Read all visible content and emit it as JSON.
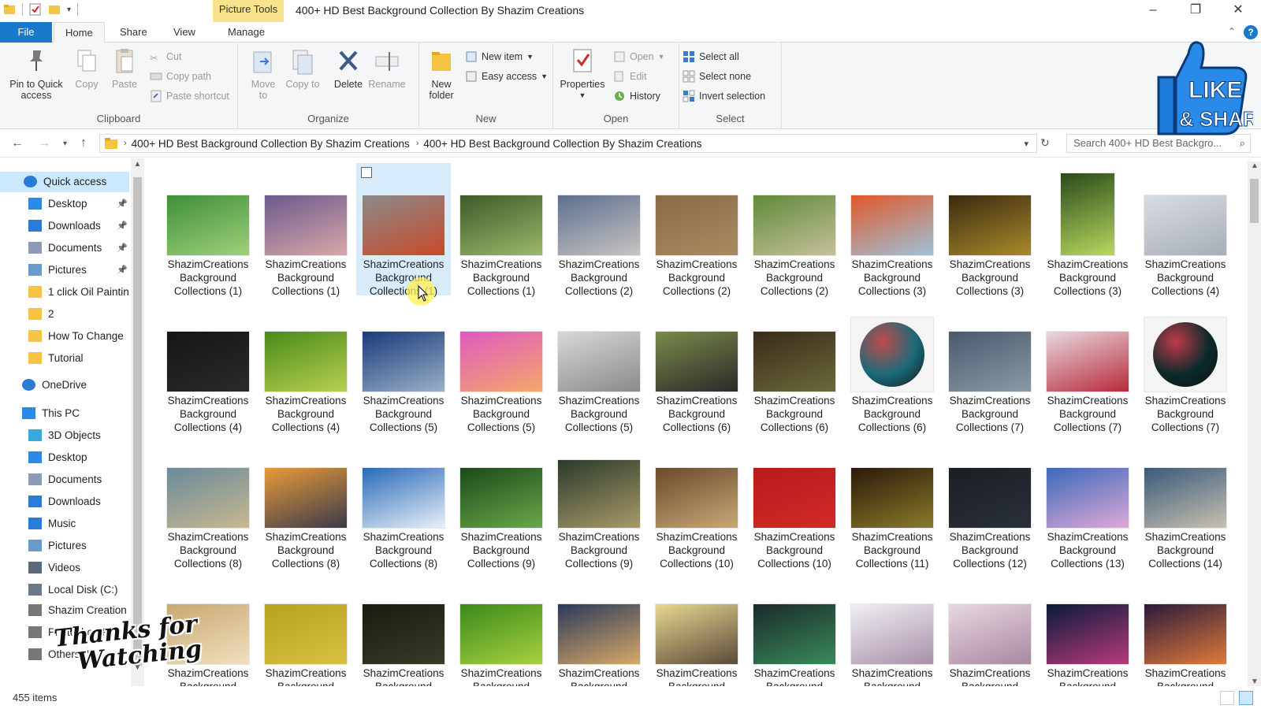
{
  "window": {
    "title": "400+ HD Best  Background Collection By Shazim Creations",
    "context_tab": "Picture Tools",
    "controls": {
      "minimize": "–",
      "restore": "❐",
      "close": "✕"
    }
  },
  "tabs": {
    "file": "File",
    "home": "Home",
    "share": "Share",
    "view": "View",
    "manage": "Manage"
  },
  "ribbon": {
    "clipboard": {
      "label": "Clipboard",
      "pin": "Pin to Quick access",
      "copy": "Copy",
      "paste": "Paste",
      "cut": "Cut",
      "copy_path": "Copy path",
      "paste_shortcut": "Paste shortcut"
    },
    "organize": {
      "label": "Organize",
      "move_to": "Move to",
      "copy_to": "Copy to",
      "delete": "Delete",
      "rename": "Rename"
    },
    "new": {
      "label": "New",
      "new_folder": "New folder",
      "new_item": "New item",
      "easy_access": "Easy access"
    },
    "open": {
      "label": "Open",
      "properties": "Properties",
      "open": "Open",
      "edit": "Edit",
      "history": "History"
    },
    "select": {
      "label": "Select",
      "select_all": "Select all",
      "select_none": "Select none",
      "invert_selection": "Invert selection"
    }
  },
  "address": {
    "crumbs": [
      "400+ HD Best  Background Collection By Shazim Creations",
      "400+ HD Best  Background Collection By Shazim Creations"
    ],
    "search_placeholder": "Search 400+ HD Best  Backgro..."
  },
  "navpane": {
    "items": [
      {
        "label": "Quick access",
        "icon": "star-icon",
        "selected": true
      },
      {
        "label": "Desktop",
        "icon": "desktop-icon",
        "pinned": true
      },
      {
        "label": "Downloads",
        "icon": "download-icon",
        "pinned": true
      },
      {
        "label": "Documents",
        "icon": "document-icon",
        "pinned": true
      },
      {
        "label": "Pictures",
        "icon": "pictures-icon",
        "pinned": true
      },
      {
        "label": "1 click Oil Paintin",
        "icon": "folder-icon"
      },
      {
        "label": "2",
        "icon": "folder-icon"
      },
      {
        "label": "How To Change",
        "icon": "folder-icon"
      },
      {
        "label": "Tutorial",
        "icon": "folder-icon"
      },
      {
        "label": "OneDrive",
        "icon": "cloud-icon"
      },
      {
        "label": "This PC",
        "icon": "computer-icon"
      },
      {
        "label": "3D Objects",
        "icon": "cube-icon"
      },
      {
        "label": "Desktop",
        "icon": "desktop-icon"
      },
      {
        "label": "Documents",
        "icon": "document-icon"
      },
      {
        "label": "Downloads",
        "icon": "download-icon"
      },
      {
        "label": "Music",
        "icon": "music-icon"
      },
      {
        "label": "Pictures",
        "icon": "pictures-icon"
      },
      {
        "label": "Videos",
        "icon": "video-icon"
      },
      {
        "label": "Local Disk (C:)",
        "icon": "disk-icon"
      },
      {
        "label": "Shazim Creation",
        "icon": "drive-icon"
      },
      {
        "label": "Photoshop File (",
        "icon": "drive-icon"
      },
      {
        "label": "Others (I:)",
        "icon": "drive-icon"
      }
    ]
  },
  "files": [
    {
      "name": "ShazimCreations Background Collections (1)",
      "c1": "#3f8f3a",
      "c2": "#9fd07a",
      "shape": "wide"
    },
    {
      "name": "ShazimCreations Background Collections (1)",
      "c1": "#6a5a8c",
      "c2": "#d9a7a9",
      "shape": "wide"
    },
    {
      "name": "ShazimCreations Background Collections (1)",
      "c1": "#8a8a8a",
      "c2": "#c94a2a",
      "shape": "wide",
      "selected": true
    },
    {
      "name": "ShazimCreations Background Collections (1)",
      "c1": "#3d5a2a",
      "c2": "#9bb86a",
      "shape": "wide"
    },
    {
      "name": "ShazimCreations Background Collections (2)",
      "c1": "#5d6f90",
      "c2": "#c8c4c0",
      "shape": "wide"
    },
    {
      "name": "ShazimCreations Background Collections (2)",
      "c1": "#8a6a45",
      "c2": "#a98a63",
      "shape": "wide"
    },
    {
      "name": "ShazimCreations Background Collections (2)",
      "c1": "#5f8a3a",
      "c2": "#c6c09a",
      "shape": "wide"
    },
    {
      "name": "ShazimCreations Background Collections (3)",
      "c1": "#e0582a",
      "c2": "#9ec2d8",
      "shape": "wide"
    },
    {
      "name": "ShazimCreations Background Collections (3)",
      "c1": "#3a2a10",
      "c2": "#a88a2a",
      "shape": "wide"
    },
    {
      "name": "ShazimCreations Background Collections (3)",
      "c1": "#2a4a1a",
      "c2": "#b8d860",
      "shape": "tall"
    },
    {
      "name": "ShazimCreations Background Collections (4)",
      "c1": "#d8dde2",
      "c2": "#a8aeb6",
      "shape": "wide"
    },
    {
      "name": "ShazimCreations Background Collections (4)",
      "c1": "#151515",
      "c2": "#2a2a2a",
      "shape": "wide"
    },
    {
      "name": "ShazimCreations Background Collections (4)",
      "c1": "#4a8a1a",
      "c2": "#b8d050",
      "shape": "wide"
    },
    {
      "name": "ShazimCreations Background Collections (5)",
      "c1": "#1a3a7a",
      "c2": "#9bb0c8",
      "shape": "wide"
    },
    {
      "name": "ShazimCreations Background Collections (5)",
      "c1": "#e05ac0",
      "c2": "#f3a86a",
      "shape": "wide"
    },
    {
      "name": "ShazimCreations Background Collections (5)",
      "c1": "#d8d8d8",
      "c2": "#8a8a8a",
      "shape": "wide"
    },
    {
      "name": "ShazimCreations Background Collections (6)",
      "c1": "#7a8a4a",
      "c2": "#2a2a2a",
      "shape": "wide"
    },
    {
      "name": "ShazimCreations Background Collections (6)",
      "c1": "#3a2a1a",
      "c2": "#6a6a3a",
      "shape": "wide"
    },
    {
      "name": "ShazimCreations Background Collections (6)",
      "c1": "#1a6a7a",
      "c2": "#c04a4a",
      "shape": "sphere"
    },
    {
      "name": "ShazimCreations Background Collections (7)",
      "c1": "#4a5a6a",
      "c2": "#8a9aa8",
      "shape": "wide"
    },
    {
      "name": "ShazimCreations Background Collections (7)",
      "c1": "#e8d8e0",
      "c2": "#b82a3a",
      "shape": "wide"
    },
    {
      "name": "ShazimCreations Background Collections (7)",
      "c1": "#0a2a2a",
      "c2": "#c03a4a",
      "shape": "sphere"
    },
    {
      "name": "ShazimCreations Background Collections (8)",
      "c1": "#6a8a9a",
      "c2": "#c8b890",
      "shape": "wide"
    },
    {
      "name": "ShazimCreations Background Collections (8)",
      "c1": "#e89a3a",
      "c2": "#3a3a4a",
      "shape": "wide"
    },
    {
      "name": "ShazimCreations Background Collections (8)",
      "c1": "#2a6ab8",
      "c2": "#e8f0f8",
      "shape": "wide"
    },
    {
      "name": "ShazimCreations Background Collections (9)",
      "c1": "#1a4a1a",
      "c2": "#6aa84a",
      "shape": "wide"
    },
    {
      "name": "ShazimCreations Background Collections (9)",
      "c1": "#2a3a2a",
      "c2": "#a89a6a",
      "shape": "tallish"
    },
    {
      "name": "ShazimCreations Background Collections (10)",
      "c1": "#6a4a2a",
      "c2": "#c8a878",
      "shape": "wide"
    },
    {
      "name": "ShazimCreations Background Collections (10)",
      "c1": "#b81a1a",
      "c2": "#d02a2a",
      "shape": "wide"
    },
    {
      "name": "ShazimCreations Background Collections (11)",
      "c1": "#2a1a0a",
      "c2": "#8a7a2a",
      "shape": "wide"
    },
    {
      "name": "ShazimCreations Background Collections (12)",
      "c1": "#1a1e24",
      "c2": "#2a3038",
      "shape": "wide"
    },
    {
      "name": "ShazimCreations Background Collections (13)",
      "c1": "#3a6ab8",
      "c2": "#e0a8d8",
      "shape": "wide"
    },
    {
      "name": "ShazimCreations Background Collections (14)",
      "c1": "#3a5a7a",
      "c2": "#c8c0b0",
      "shape": "wide"
    },
    {
      "name": "ShazimCreations Background",
      "c1": "#c8a870",
      "c2": "#f0e0c0",
      "shape": "wide"
    },
    {
      "name": "ShazimCreations Background",
      "c1": "#b8a020",
      "c2": "#d8c040",
      "shape": "wide"
    },
    {
      "name": "ShazimCreations Background",
      "c1": "#1a1a10",
      "c2": "#3a3a28",
      "shape": "wide"
    },
    {
      "name": "ShazimCreations Background",
      "c1": "#3a8a1a",
      "c2": "#a8d040",
      "shape": "wide"
    },
    {
      "name": "ShazimCreations Background",
      "c1": "#2a3a5a",
      "c2": "#d8a868",
      "shape": "wide"
    },
    {
      "name": "ShazimCreations Background",
      "c1": "#e8d890",
      "c2": "#5a4a3a",
      "shape": "wide"
    },
    {
      "name": "ShazimCreations Background",
      "c1": "#1a2a2a",
      "c2": "#3a8a5a",
      "shape": "wide"
    },
    {
      "name": "ShazimCreations Background",
      "c1": "#f0f0f4",
      "c2": "#a890a8",
      "shape": "wide"
    },
    {
      "name": "ShazimCreations Background",
      "c1": "#e8d8e0",
      "c2": "#a888a0",
      "shape": "wide"
    },
    {
      "name": "ShazimCreations Background",
      "c1": "#0a1a3a",
      "c2": "#b83a7a",
      "shape": "wide"
    },
    {
      "name": "ShazimCreations Background",
      "c1": "#2a1a3a",
      "c2": "#e07a3a",
      "shape": "wide"
    }
  ],
  "status": {
    "item_count": "455 items"
  },
  "overlays": {
    "like_line1": "LIKE",
    "like_line2": "& SHARE",
    "thanks_line1": "Thanks for",
    "thanks_line2": "Watching"
  },
  "colors": {
    "accent": "#1979ca",
    "selection": "#cce8ff",
    "context_tab": "#f8e38c"
  }
}
